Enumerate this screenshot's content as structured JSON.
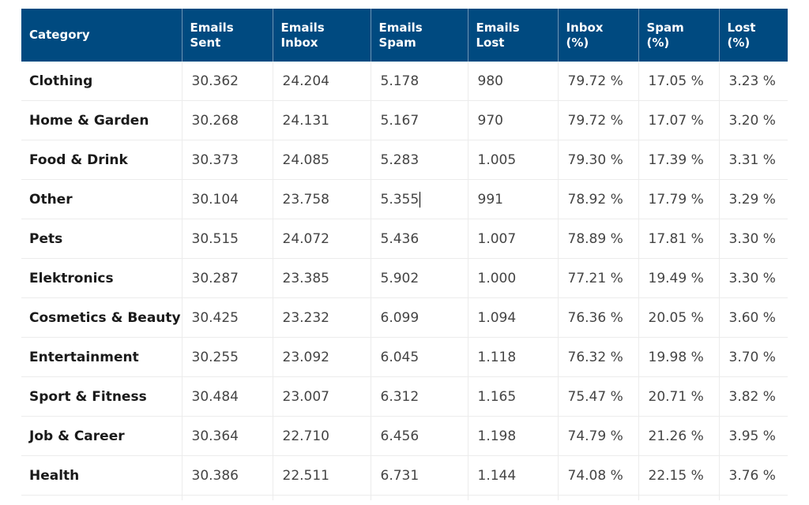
{
  "table": {
    "headers": [
      [
        "Category"
      ],
      [
        "Emails",
        "Sent"
      ],
      [
        "Emails",
        "Inbox"
      ],
      [
        "Emails",
        "Spam"
      ],
      [
        "Emails",
        "Lost"
      ],
      [
        "Inbox",
        "(%)"
      ],
      [
        "Spam",
        "(%)"
      ],
      [
        "Lost",
        "(%)"
      ]
    ],
    "header_color": "#004a80",
    "rows": [
      [
        "Clothing",
        "30.362",
        "24.204",
        "5.178",
        "980",
        "79.72 %",
        "17.05 %",
        "3.23 %"
      ],
      [
        "Home & Garden",
        "30.268",
        "24.131",
        "5.167",
        "970",
        "79.72 %",
        "17.07 %",
        "3.20 %"
      ],
      [
        "Food & Drink",
        "30.373",
        "24.085",
        "5.283",
        "1.005",
        "79.30 %",
        "17.39 %",
        "3.31 %"
      ],
      [
        "Other",
        "30.104",
        "23.758",
        "5.355",
        "991",
        "78.92 %",
        "17.79 %",
        "3.29 %"
      ],
      [
        "Pets",
        "30.515",
        "24.072",
        "5.436",
        "1.007",
        "78.89 %",
        "17.81 %",
        "3.30 %"
      ],
      [
        "Elektronics",
        "30.287",
        "23.385",
        "5.902",
        "1.000",
        "77.21 %",
        "19.49 %",
        "3.30 %"
      ],
      [
        "Cosmetics & Beauty",
        "30.425",
        "23.232",
        "6.099",
        "1.094",
        "76.36 %",
        "20.05 %",
        "3.60 %"
      ],
      [
        "Entertainment",
        "30.255",
        "23.092",
        "6.045",
        "1.118",
        "76.32 %",
        "19.98 %",
        "3.70 %"
      ],
      [
        "Sport & Fitness",
        "30.484",
        "23.007",
        "6.312",
        "1.165",
        "75.47 %",
        "20.71 %",
        "3.82 %"
      ],
      [
        "Job & Career",
        "30.364",
        "22.710",
        "6.456",
        "1.198",
        "74.79 %",
        "21.26 %",
        "3.95 %"
      ],
      [
        "Health",
        "30.386",
        "22.511",
        "6.731",
        "1.144",
        "74.08 %",
        "22.15 %",
        "3.76 %"
      ]
    ],
    "cursor_cell": {
      "row": 3,
      "col": 3
    }
  }
}
